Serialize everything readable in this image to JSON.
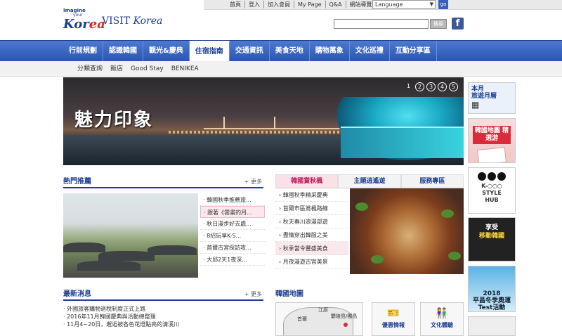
{
  "util": {
    "links": [
      "首頁",
      "登入",
      "加入會員",
      "My Page",
      "Q&A",
      "網站導覽"
    ],
    "language": "Language",
    "go": "go"
  },
  "logo": {
    "imagine": "Imagine",
    "your": "your",
    "korea_1": "Kor",
    "korea_2": "ea",
    "visit": "VISIT",
    "korea_text": "Korea"
  },
  "search": {
    "button": "搜尋",
    "fb": "f"
  },
  "nav": {
    "items": [
      "行前規劃",
      "認識韓國",
      "觀光&慶典",
      "住宿指南",
      "交通資訊",
      "美食天地",
      "購物萬象",
      "文化巡禮",
      "互動分享區"
    ],
    "active": "住宿指南"
  },
  "subnav": {
    "items": [
      "分類查詢",
      "飯店",
      "Good Stay",
      "BENIKEA"
    ]
  },
  "hero": {
    "title": "魅力印象",
    "pages": [
      "1",
      "2",
      "3",
      "4",
      "5"
    ]
  },
  "side": {
    "b1_line1": "本月",
    "b1_line2": "旅遊月曆",
    "b2": "韓國地圖 精選游",
    "b3_line1": "K-○○○",
    "b3_line2": "STYLE",
    "b3_line3": "HUB",
    "b4_line1": "享受",
    "b4_line2": "移動韓國",
    "b5_line1": "2018",
    "b5_line2": "平昌冬季奧運",
    "b5_line3": "Test活動"
  },
  "hot": {
    "title": "熱門推薦",
    "more": "更多",
    "items": [
      "韓國秋季推薦旅...",
      "跟著《雲畫的月...",
      "秋日漫步好去處...",
      "8招玩享K-S...",
      "首爾古宮探訪攻...",
      "大邱2天1夜深..."
    ]
  },
  "tabs": {
    "items": [
      "韓國賞秋楓",
      "主題逍遙遊",
      "服務專區"
    ],
    "list": [
      "韓國秋季精采慶典",
      "首爾市區賞楓路線",
      "秋天春川浪漫部遊",
      "盡情穿出韓服之美",
      "秋季當令豐盛美食",
      "月夜漫遊古宮美景"
    ]
  },
  "news": {
    "title": "最新消息",
    "more": "更多",
    "items": [
      "外國旅客購物退稅制度正式上路",
      "2016年11月韓國慶典與活動總整理",
      "11月4~20日，邂逅被各色花燈點亮的清溪川"
    ]
  },
  "map": {
    "title": "韓國地圖",
    "label_gangwon": "江原",
    "label_seoul": "首爾",
    "label_jeolla": "鬱陵島/獨島",
    "coupon_label": "優惠情報",
    "culture_label": "文化體驗",
    "coupon_icon": "ticket-icon",
    "culture_icon": "people-icon"
  },
  "colors": {
    "brand_blue": "#1c3f94",
    "nav_blue": "#2a56b2",
    "brand_red": "#d4262a",
    "highlight_pink": "#fbe8ec"
  }
}
